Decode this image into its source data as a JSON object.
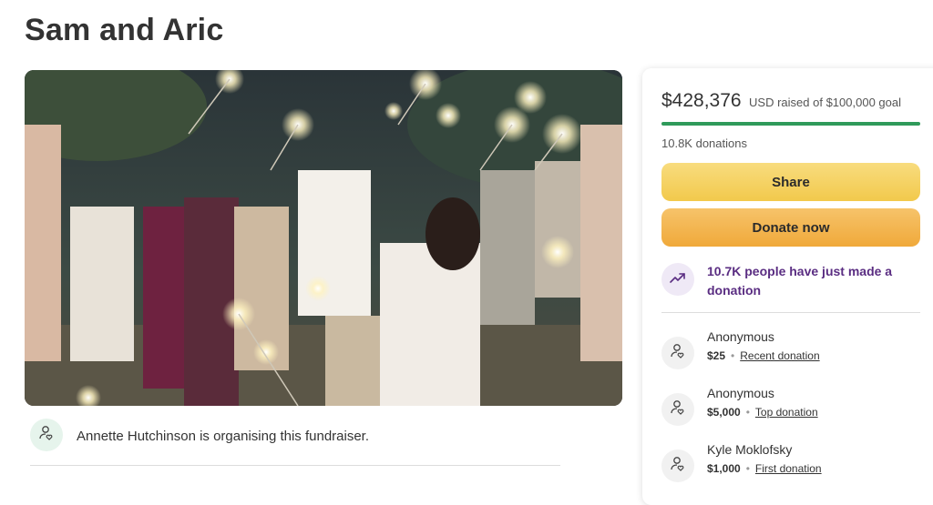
{
  "page": {
    "title": "Sam and Aric"
  },
  "organiser": {
    "text": "Annette Hutchinson is organising this fundraiser."
  },
  "donation_panel": {
    "amount_raised": "$428,376",
    "goal_text": "USD raised of $100,000 goal",
    "progress_fraction": 1.0,
    "donation_count": "10.8K donations",
    "share_label": "Share",
    "donate_label": "Donate now",
    "trend_text": "10.7K people have just made a donation",
    "donors": [
      {
        "name": "Anonymous",
        "amount": "$25",
        "tag": "Recent donation"
      },
      {
        "name": "Anonymous",
        "amount": "$5,000",
        "tag": "Top donation"
      },
      {
        "name": "Kyle Moklofsky",
        "amount": "$1,000",
        "tag": "First donation"
      }
    ]
  },
  "colors": {
    "progress": "#2f9a5a",
    "share_button": "#f2c94c",
    "donate_button": "#f0a93a",
    "trend_text": "#5a2d82"
  }
}
